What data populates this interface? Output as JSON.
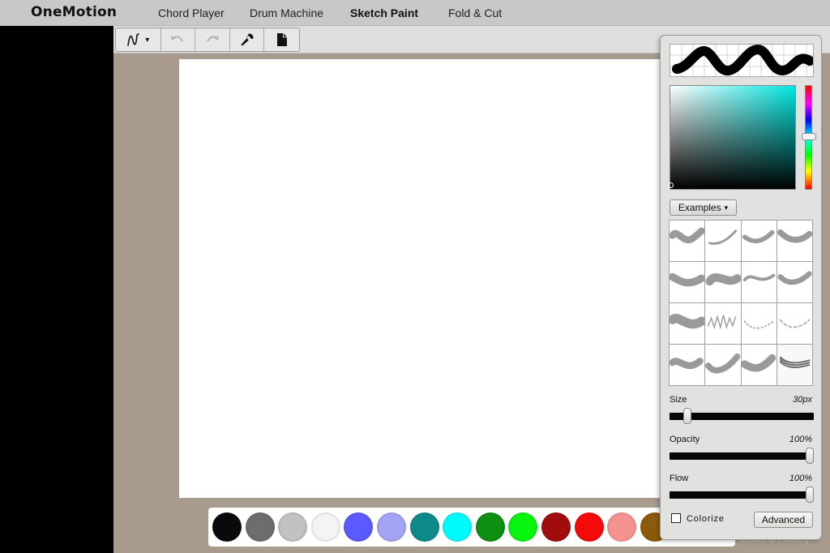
{
  "nav": {
    "logo": "OneMotion",
    "links": [
      {
        "label": "Chord Player",
        "active": false
      },
      {
        "label": "Drum Machine",
        "active": false
      },
      {
        "label": "Sketch Paint",
        "active": true
      },
      {
        "label": "Fold & Cut",
        "active": false
      }
    ]
  },
  "toolbar": {
    "tools": [
      {
        "name": "brush-tool-dropdown",
        "icon": "brush-stroke-icon",
        "caret": "▾"
      },
      {
        "name": "undo-button",
        "icon": "undo-icon"
      },
      {
        "name": "redo-button",
        "icon": "redo-icon"
      },
      {
        "name": "settings-button",
        "icon": "wrench-icon"
      },
      {
        "name": "new-document-button",
        "icon": "document-icon"
      }
    ]
  },
  "palette": {
    "colors": [
      "#0a0a0a",
      "#6d6d6d",
      "#c2c2c2",
      "#f4f4f4",
      "#5a5aff",
      "#a4a4f5",
      "#0e8a8a",
      "#00fbfb",
      "#0e8f12",
      "#08f510",
      "#a10d0d",
      "#f50a0a",
      "#f59391",
      "#8b5a0a"
    ]
  },
  "footer": {
    "link": "Terms & Privacy"
  },
  "brush_panel": {
    "picker_color": "#00e6e1",
    "examples_label": "Examples",
    "examples_caret": "▾",
    "size": {
      "label": "Size",
      "value": "30px",
      "fraction": 0.1
    },
    "opacity": {
      "label": "Opacity",
      "value": "100%",
      "fraction": 1.0
    },
    "flow": {
      "label": "Flow",
      "value": "100%",
      "fraction": 1.0
    },
    "colorize": {
      "label": "Colorize",
      "checked": false
    },
    "advanced_label": "Advanced",
    "brushes": [
      {
        "name": "brush-soft-thick"
      },
      {
        "name": "brush-thin-curve"
      },
      {
        "name": "brush-medium-curve"
      },
      {
        "name": "brush-soft-wide"
      },
      {
        "name": "brush-airbrush"
      },
      {
        "name": "brush-shaded"
      },
      {
        "name": "brush-ribbon"
      },
      {
        "name": "brush-soft-gray"
      },
      {
        "name": "brush-chalk"
      },
      {
        "name": "brush-grass"
      },
      {
        "name": "brush-dotted"
      },
      {
        "name": "brush-dashed"
      },
      {
        "name": "brush-splatter"
      },
      {
        "name": "brush-fur"
      },
      {
        "name": "brush-ink"
      },
      {
        "name": "brush-multiline"
      }
    ]
  }
}
